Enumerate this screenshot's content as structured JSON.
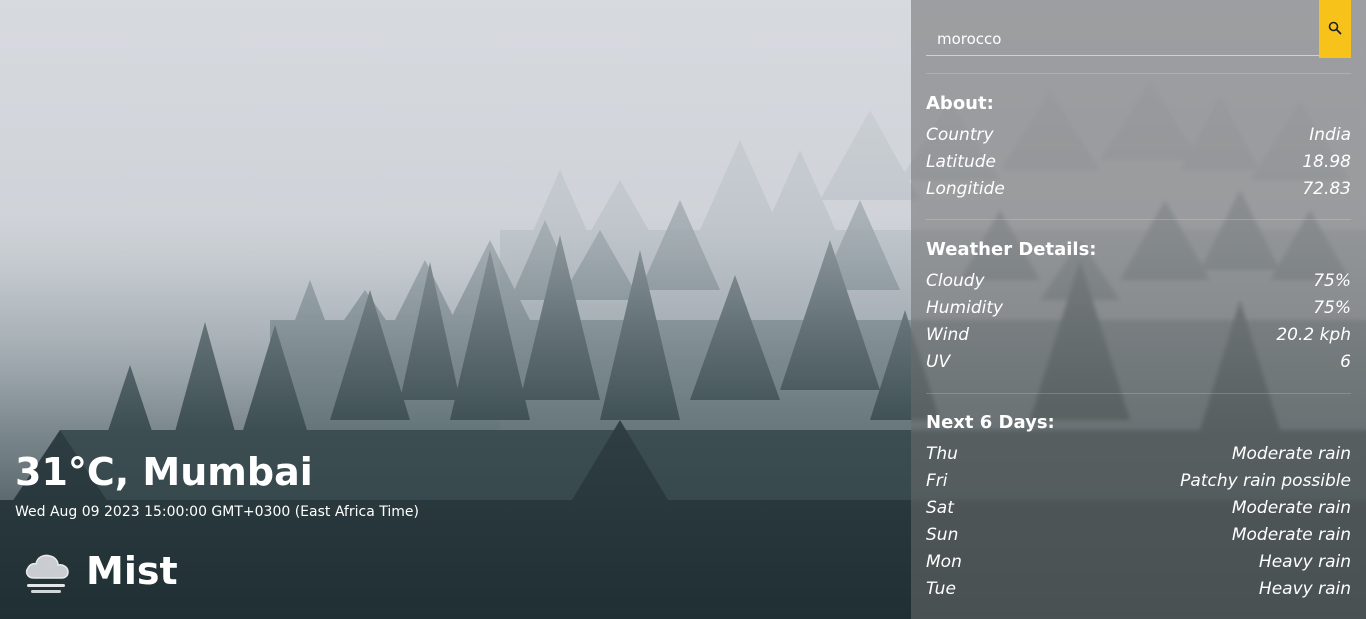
{
  "current": {
    "temp_city": "31°C, Mumbai",
    "datetime": "Wed Aug 09 2023 15:00:00 GMT+0300 (East Africa Time)",
    "condition": "Mist",
    "condition_icon": "cloud-mist-icon"
  },
  "search": {
    "value": "morocco",
    "button_icon": "search-icon",
    "button_color": "#f7c21a"
  },
  "about": {
    "title": "About:",
    "rows": [
      {
        "label": "Country",
        "value": "India"
      },
      {
        "label": "Latitude",
        "value": "18.98"
      },
      {
        "label": "Longitide",
        "value": "72.83"
      }
    ]
  },
  "details": {
    "title": "Weather Details:",
    "rows": [
      {
        "label": "Cloudy",
        "value": "75%"
      },
      {
        "label": "Humidity",
        "value": "75%"
      },
      {
        "label": "Wind",
        "value": "20.2 kph"
      },
      {
        "label": "UV",
        "value": "6"
      }
    ]
  },
  "forecast": {
    "title": "Next 6 Days:",
    "rows": [
      {
        "day": "Thu",
        "desc": "Moderate rain"
      },
      {
        "day": "Fri",
        "desc": "Patchy rain possible"
      },
      {
        "day": "Sat",
        "desc": "Moderate rain"
      },
      {
        "day": "Sun",
        "desc": "Moderate rain"
      },
      {
        "day": "Mon",
        "desc": "Heavy rain"
      },
      {
        "day": "Tue",
        "desc": "Heavy rain"
      }
    ]
  }
}
